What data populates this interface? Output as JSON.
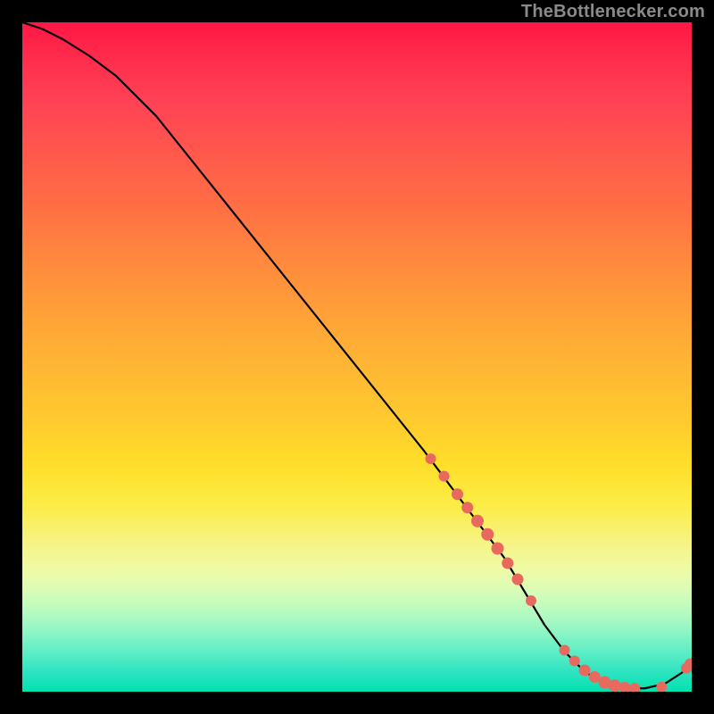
{
  "watermark": "TheBottlenecker.com",
  "chart_data": {
    "type": "line",
    "title": "",
    "xlabel": "",
    "ylabel": "",
    "xlim": [
      0,
      100
    ],
    "ylim": [
      0,
      100
    ],
    "grid": false,
    "series": [
      {
        "name": "curve",
        "x": [
          0,
          3,
          6,
          10,
          14,
          20,
          28,
          36,
          44,
          52,
          60,
          66,
          72,
          75,
          78,
          81,
          84,
          87,
          90,
          93,
          96,
          98.5,
          100
        ],
        "y": [
          100,
          99,
          97.5,
          95,
          92,
          86,
          76,
          66,
          56,
          46,
          36,
          28,
          20,
          15,
          10,
          6,
          3,
          1.2,
          0.5,
          0.5,
          1.2,
          2.8,
          4.2
        ]
      }
    ],
    "markers": {
      "name": "points",
      "x": [
        61,
        63,
        65,
        66.5,
        68,
        69.5,
        71,
        72.5,
        74,
        76,
        81,
        82.5,
        84,
        85.5,
        87,
        88.5,
        90,
        91.5,
        95.5,
        99.2,
        99.8
      ],
      "y": [
        34.8,
        32.2,
        29.5,
        27.5,
        25.5,
        23.5,
        21.4,
        19.2,
        16.8,
        13.6,
        6.2,
        4.6,
        3.2,
        2.2,
        1.4,
        0.9,
        0.6,
        0.5,
        0.7,
        3.5,
        4.1
      ],
      "r": [
        6,
        6,
        6.5,
        6.5,
        7,
        7,
        7,
        6.5,
        6.5,
        6,
        6,
        6,
        6.5,
        6.5,
        7,
        7,
        6.5,
        6,
        6,
        6,
        6.5
      ]
    }
  }
}
